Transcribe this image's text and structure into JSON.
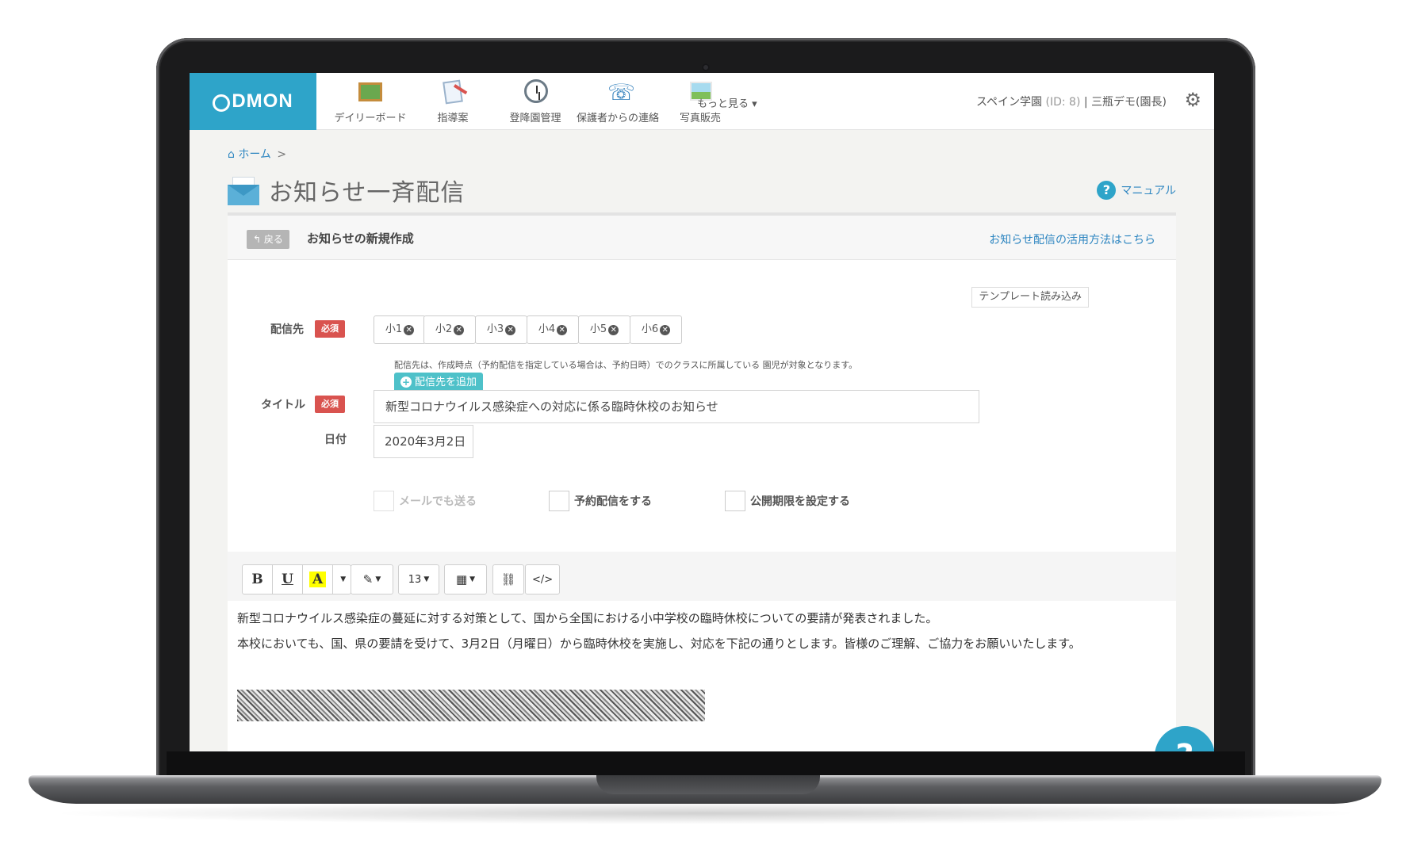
{
  "brand": {
    "logo_text": "DMON",
    "logo_prefix": "C",
    "color": "#2ea4c9"
  },
  "nav": {
    "items": [
      {
        "label": "デイリーボード",
        "icon": "blackboard-icon"
      },
      {
        "label": "指導案",
        "icon": "lesson-plan-icon"
      },
      {
        "label": "登降園管理",
        "icon": "clock-icon"
      },
      {
        "label": "保護者からの連絡",
        "icon": "phone-icon"
      },
      {
        "label": "写真販売",
        "icon": "photo-icon"
      }
    ],
    "more_label": "もっと見る ▾"
  },
  "user": {
    "school": "スペイン学園",
    "id_label": "(ID: 8)",
    "separator": "|",
    "name": "三瓶デモ(園長)"
  },
  "breadcrumb": {
    "home": "ホーム",
    "separator": ">"
  },
  "page": {
    "title": "お知らせ一斉配信",
    "manual_label": "マニュアル"
  },
  "panel": {
    "back_label": "戻る",
    "title": "お知らせの新規作成",
    "howto_link": "お知らせ配信の活用方法はこちら",
    "template_button": "テンプレート読み込み"
  },
  "form": {
    "required_badge": "必須",
    "destination_label": "配信先",
    "classes": [
      "小1",
      "小2",
      "小3",
      "小4",
      "小5",
      "小6"
    ],
    "destination_note": "配信先は、作成時点（予約配信を指定している場合は、予約日時）でのクラスに所属している 園児が対象となります。",
    "add_destination_label": "配信先を追加",
    "title_label": "タイトル",
    "title_value": "新型コロナウイルス感染症への対応に係る臨時休校のお知らせ",
    "date_label": "日付",
    "date_value": "2020年3月2日",
    "checkboxes": [
      {
        "label": "メールでも送る",
        "checked": false,
        "enabled": false
      },
      {
        "label": "予約配信をする",
        "checked": false,
        "enabled": true
      },
      {
        "label": "公開期限を設定する",
        "checked": false,
        "enabled": true
      }
    ]
  },
  "editor": {
    "toolbar": {
      "bold": "B",
      "underline": "U",
      "color": "A",
      "font_size": "13",
      "code": "</>"
    },
    "paragraphs": [
      "新型コロナウイルス感染症の蔓延に対する対策として、国から全国における小中学校の臨時休校についての要請が発表されました。",
      "本校においても、国、県の要請を受けて、3月2日（月曜日）から臨時休校を実施し、対応を下記の通りとします。皆様のご理解、ご協力をお願いいたします。"
    ]
  },
  "help_fab": "?"
}
